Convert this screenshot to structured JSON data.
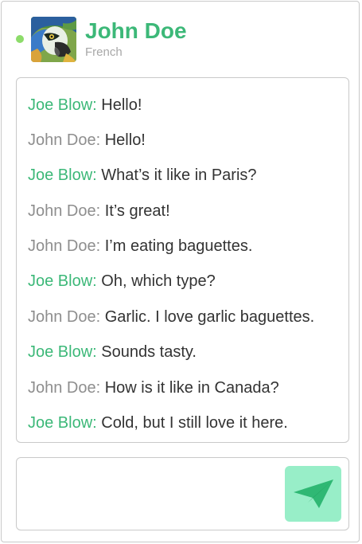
{
  "theme": {
    "accent": "#3cb878",
    "peer_name_color": "#8e8e8e",
    "online_color": "#8ddc6a",
    "send_bg": "#98eec8",
    "send_icon_color": "#2fb874"
  },
  "contact": {
    "name": "John Doe",
    "language": "French",
    "status": "online",
    "avatar_icon": "parrot-avatar-icon"
  },
  "messages": [
    {
      "sender": "Joe Blow:",
      "text": "Hello!",
      "role": "me"
    },
    {
      "sender": "John Doe:",
      "text": "Hello!",
      "role": "peer"
    },
    {
      "sender": "Joe Blow:",
      "text": "What’s it like in Paris?",
      "role": "me"
    },
    {
      "sender": "John Doe:",
      "text": "It’s great!",
      "role": "peer"
    },
    {
      "sender": "John Doe:",
      "text": "I’m eating baguettes.",
      "role": "peer"
    },
    {
      "sender": "Joe Blow:",
      "text": "Oh, which type?",
      "role": "me"
    },
    {
      "sender": "John Doe:",
      "text": "Garlic. I love garlic baguettes.",
      "role": "peer"
    },
    {
      "sender": "Joe Blow:",
      "text": "Sounds tasty.",
      "role": "me"
    },
    {
      "sender": "John Doe:",
      "text": "How is it like in Canada?",
      "role": "peer"
    },
    {
      "sender": "Joe Blow:",
      "text": "Cold, but I still love it here.",
      "role": "me"
    }
  ],
  "composer": {
    "value": "",
    "send_icon": "paper-plane-icon"
  }
}
